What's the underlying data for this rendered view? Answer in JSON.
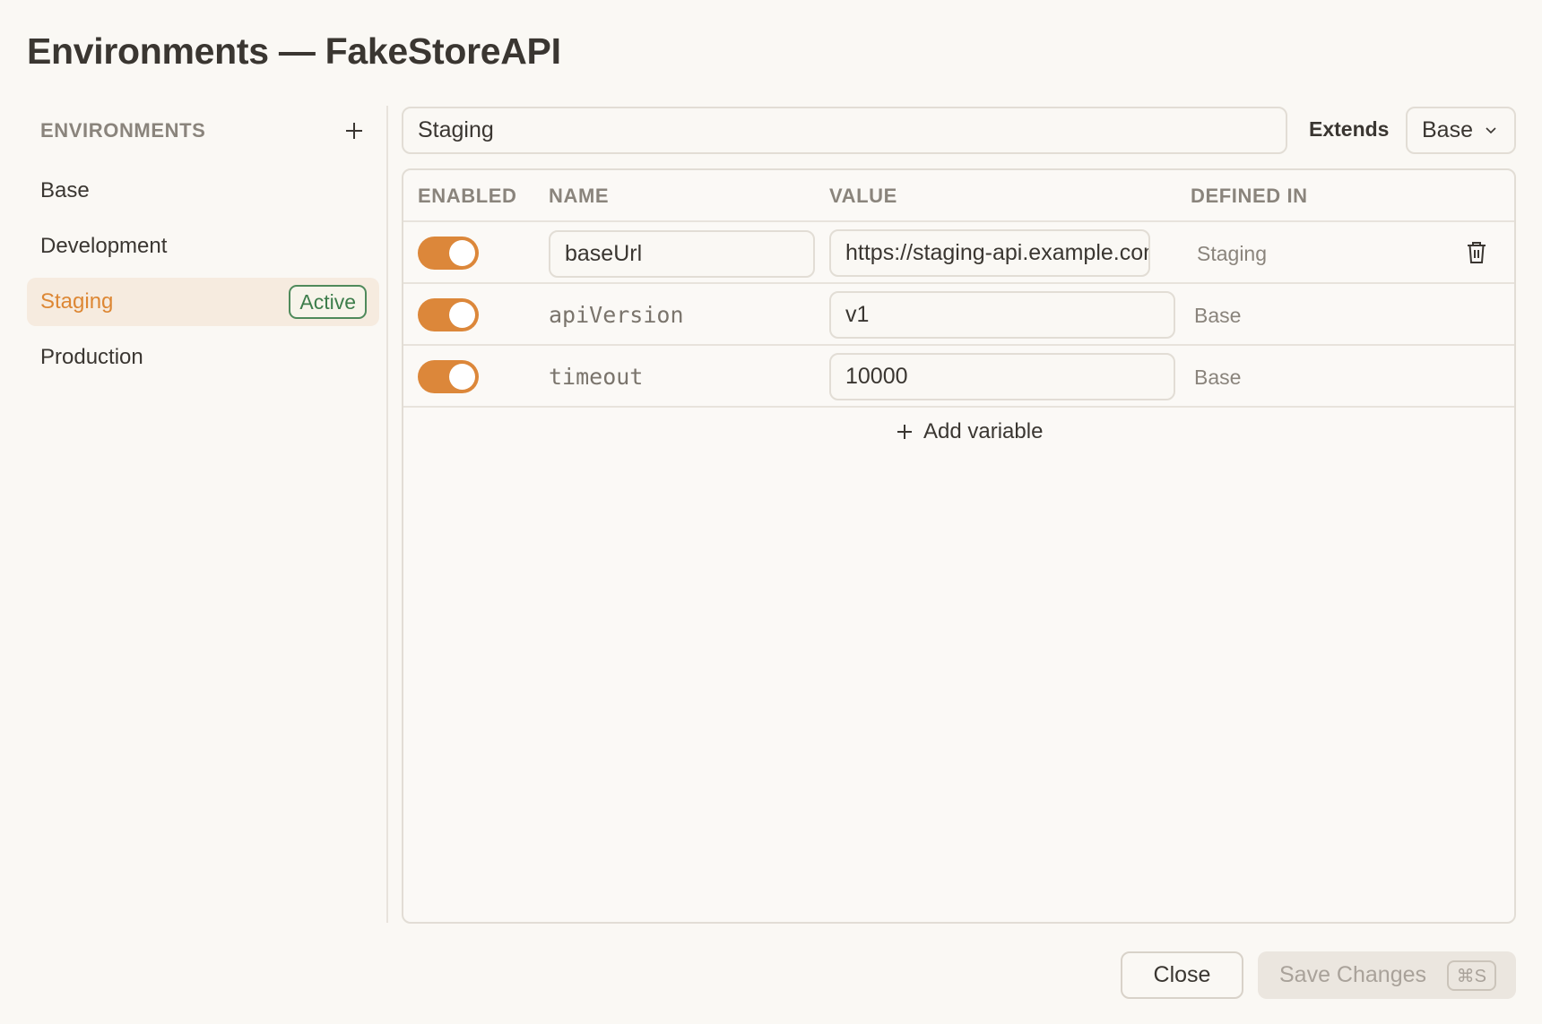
{
  "dialog": {
    "title": "Environments — FakeStoreAPI"
  },
  "sidebar": {
    "header": "ENVIRONMENTS",
    "add_icon": "plus-icon",
    "items": [
      {
        "label": "Base",
        "active": false
      },
      {
        "label": "Development",
        "active": false
      },
      {
        "label": "Staging",
        "active": true,
        "badge": "Active"
      },
      {
        "label": "Production",
        "active": false
      }
    ]
  },
  "editor": {
    "environment_name": "Staging",
    "extends_label": "Extends",
    "extends_value": "Base",
    "columns": [
      "ENABLED",
      "NAME",
      "VALUE",
      "DEFINED IN"
    ],
    "variables": [
      {
        "enabled": true,
        "name": "baseUrl",
        "value": "https://staging-api.example.com",
        "defined_in": "Staging",
        "editable_name": true
      },
      {
        "enabled": true,
        "name": "apiVersion",
        "value": "v1",
        "defined_in": "Base",
        "editable_name": false
      },
      {
        "enabled": true,
        "name": "timeout",
        "value": "10000",
        "defined_in": "Base",
        "editable_name": false
      }
    ],
    "add_variable_label": "Add variable"
  },
  "footer": {
    "close_label": "Close",
    "save_label": "Save Changes",
    "save_shortcut": "⌘S"
  },
  "colors": {
    "accent": "#dc873a",
    "active_badge": "#3d7d4b",
    "background": "#faf8f4"
  }
}
